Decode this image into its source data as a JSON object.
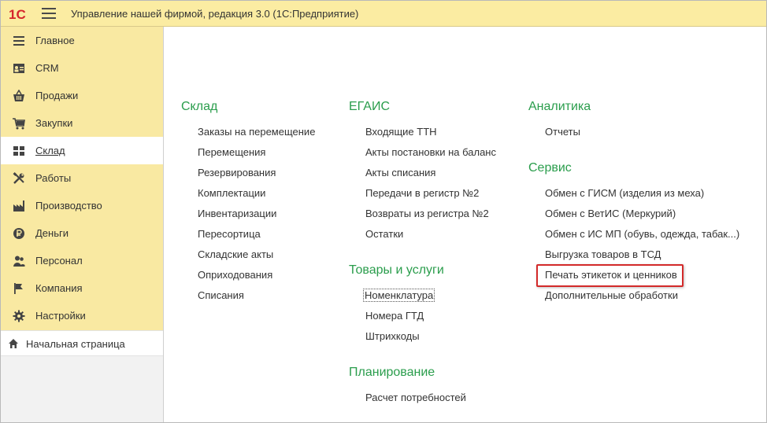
{
  "app": {
    "logo_text": "1С",
    "title": "Управление нашей фирмой, редакция 3.0  (1С:Предприятие)"
  },
  "colors": {
    "sidebar_bg": "#f9e9a2",
    "titlebar_bg": "#fbeca2",
    "section_title": "#2a9d4c",
    "highlight_border": "#d32a2a",
    "logo_red": "#d6262c"
  },
  "sidebar": {
    "items": [
      {
        "label": "Главное",
        "icon": "menu-lines-icon"
      },
      {
        "label": "CRM",
        "icon": "contact-card-icon"
      },
      {
        "label": "Продажи",
        "icon": "shopping-basket-icon"
      },
      {
        "label": "Закупки",
        "icon": "cart-icon"
      },
      {
        "label": "Склад",
        "icon": "warehouse-icon",
        "active": true
      },
      {
        "label": "Работы",
        "icon": "tools-icon"
      },
      {
        "label": "Производство",
        "icon": "factory-icon"
      },
      {
        "label": "Деньги",
        "icon": "ruble-coin-icon"
      },
      {
        "label": "Персонал",
        "icon": "people-icon"
      },
      {
        "label": "Компания",
        "icon": "flag-icon"
      },
      {
        "label": "Настройки",
        "icon": "gear-icon"
      }
    ],
    "start_page": {
      "label": "Начальная страница",
      "icon": "home-icon"
    }
  },
  "sections": {
    "sklad": {
      "title": "Склад",
      "links": [
        "Заказы на перемещение",
        "Перемещения",
        "Резервирования",
        "Комплектации",
        "Инвентаризации",
        "Пересортица",
        "Складские акты",
        "Оприходования",
        "Списания"
      ]
    },
    "egais": {
      "title": "ЕГАИС",
      "links": [
        "Входящие ТТН",
        "Акты постановки на баланс",
        "Акты списания",
        "Передачи в регистр №2",
        "Возвраты из регистра №2",
        "Остатки"
      ]
    },
    "goods": {
      "title": "Товары и услуги",
      "links": [
        "Номенклатура",
        "Номера ГТД",
        "Штрихкоды"
      ]
    },
    "planning": {
      "title": "Планирование",
      "links": [
        "Расчет потребностей"
      ]
    },
    "analytics": {
      "title": "Аналитика",
      "links": [
        "Отчеты"
      ]
    },
    "service": {
      "title": "Сервис",
      "links": [
        "Обмен с ГИСМ (изделия из меха)",
        "Обмен с ВетИС (Меркурий)",
        "Обмен с ИС МП (обувь, одежда, табак...)",
        "Выгрузка товаров в ТСД",
        "Печать этикеток и ценников",
        "Дополнительные обработки"
      ]
    }
  }
}
